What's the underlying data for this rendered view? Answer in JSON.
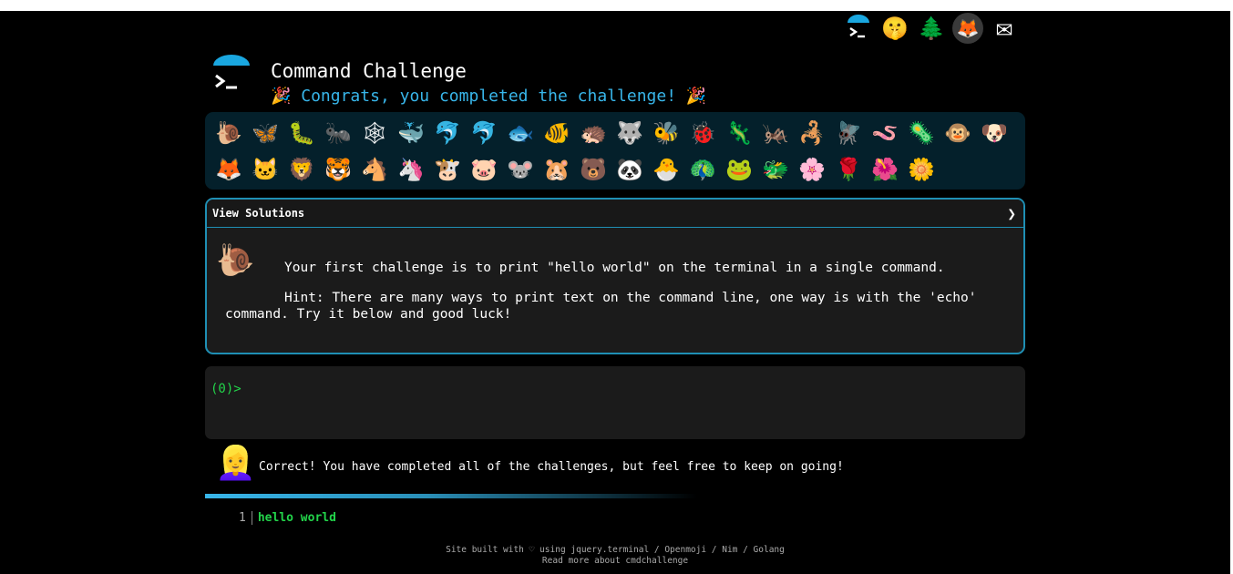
{
  "header": {
    "title": "Command Challenge",
    "subtitle": "🎉 Congrats, you completed the challenge! 🎉"
  },
  "nav": [
    {
      "name": "terminal-icon",
      "glyph": ">_"
    },
    {
      "name": "shushing-face-icon",
      "glyph": "🤫"
    },
    {
      "name": "tree-icon",
      "glyph": "🌲"
    },
    {
      "name": "gitlab-icon",
      "glyph": "🦊"
    },
    {
      "name": "mail-icon",
      "glyph": "✉"
    }
  ],
  "emoji_rows": [
    [
      "🐌",
      "🦋",
      "🐛",
      "🐜",
      "🕸",
      "🐳",
      "🐬",
      "🐬",
      "🐟",
      "🐠",
      "🦔",
      "🐺",
      "🐝",
      "🐞",
      "🦎",
      "🦗",
      "🦂",
      "🪰",
      "🪱",
      "🦠",
      "🐵",
      "🐶"
    ],
    [
      "🦊",
      "🐱",
      "🦁",
      "🐯",
      "🐴",
      "🦄",
      "🐮",
      "🐷",
      "🐭",
      "🐹",
      "🐻",
      "🐼",
      "🐣",
      "🦚",
      "🐸",
      "🐲",
      "🌸",
      "🌹",
      "🌺",
      "🌼"
    ]
  ],
  "challenge": {
    "header_label": "View Solutions",
    "chevron": "❯",
    "icon": "🐌",
    "text_1": "Your first challenge is to print \"hello world\" on the terminal in a single command.",
    "text_2": "Hint: There are many ways to print text on the command line, one way is with the 'echo' command. Try it below and good luck!"
  },
  "terminal": {
    "prompt": "(0)>"
  },
  "feedback": {
    "avatar": "👱‍♀️",
    "message": "Correct! You have completed all of the challenges, but feel free to keep on going!"
  },
  "output": {
    "line_number": "1",
    "text": "hello world"
  },
  "footer": {
    "line1": "Site built with ♡ using jquery.terminal / Openmoji / Nim / Golang",
    "line2": "Read more about cmdchallenge"
  },
  "colors": {
    "accent": "#38b6ea",
    "prompt_green": "#22d44a",
    "panel_bg": "#04202b",
    "border": "#1f8fb4"
  }
}
